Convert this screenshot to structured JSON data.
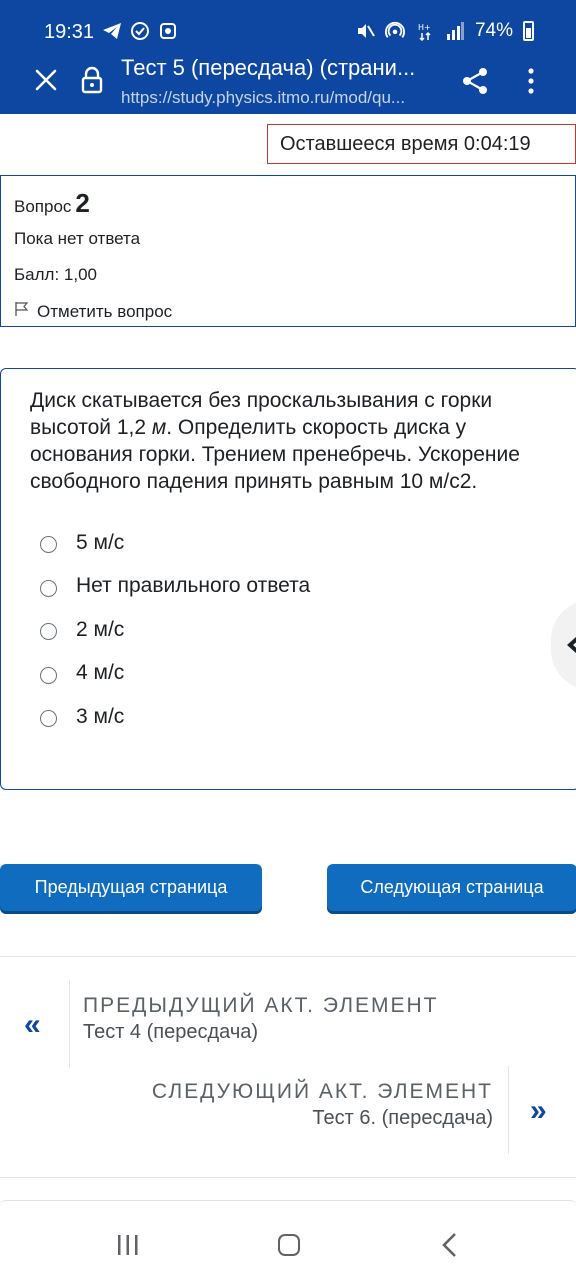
{
  "status_bar": {
    "time": "19:31",
    "battery": "74%",
    "icons": [
      "telegram-icon",
      "check-circle-icon",
      "notification-icon",
      "mute-icon",
      "hotspot-icon",
      "data-icon",
      "signal-icon",
      "battery-icon"
    ]
  },
  "browser": {
    "title": "Тест 5 (пересдача) (страни...",
    "url": "https://study.physics.itmo.ru/mod/qu...",
    "theme_color": "#0d47a1"
  },
  "timer": {
    "text": "Оставшееся время 0:04:19"
  },
  "question_info": {
    "label": "Вопрос",
    "number": "2",
    "state": "Пока нет ответа",
    "grade": "Балл: 1,00",
    "flag_label": "Отметить вопрос"
  },
  "question": {
    "text_part1": "Диск скатывается без проскальзывания с горки высотой 1,2 ",
    "text_italic": "м",
    "text_part2": ". Определить скорость диска у основания горки. Трением пренебречь. Ускорение свободного падения принять равным 10 м/с2.",
    "answers": [
      {
        "label": "5 м/с",
        "selected": false
      },
      {
        "label": "Нет правильного ответа",
        "selected": false
      },
      {
        "label": "2 м/с",
        "selected": false
      },
      {
        "label": "4 м/с",
        "selected": false
      },
      {
        "label": "3 м/с",
        "selected": false
      }
    ]
  },
  "navigation": {
    "prev_button": "Предыдущая страница",
    "next_button": "Следующая страница",
    "button_color": "#0f6cbf"
  },
  "activity_nav": {
    "prev_kicker": "ПРЕДЫДУЩИЙ АКТ. ЭЛЕМЕНТ",
    "prev_name": "Тест 4 (пересдача)",
    "prev_arrow": "«",
    "next_kicker": "СЛЕДУЮЩИЙ АКТ. ЭЛЕМЕНТ",
    "next_name": "Тест 6. (пересдача)",
    "next_arrow": "»"
  }
}
